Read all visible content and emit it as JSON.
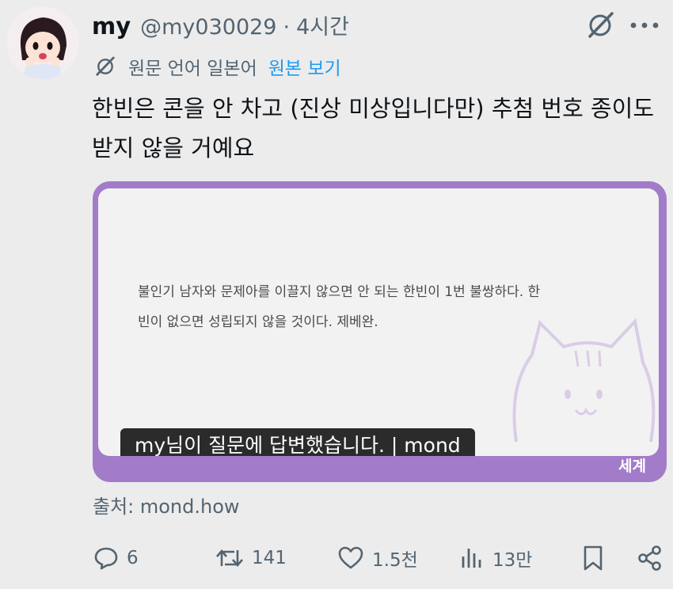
{
  "post": {
    "display_name": "my",
    "handle": "@my030029",
    "separator": "·",
    "time": "4시간",
    "translation": {
      "source_lang": "원문 언어 일본어",
      "view_original": "원본 보기"
    },
    "text": "한빈은 콘을 안 차고 (진상 미상입니다만) 추첨 번호 종이도 받지 않을 거예요",
    "card": {
      "quote": "불인기 남자와 문제아를 이끌지 않으면 안 되는 한빈이 1번 불쌍하다. 한빈이 없으면 성립되지 않을 것이다. 제베완.",
      "caption": "my님이 질문에 답변했습니다. | mond",
      "corner_label": "세계"
    },
    "source": "출처: mond.how",
    "stats": {
      "replies": "6",
      "reposts": "141",
      "likes": "1.5천",
      "views": "13만"
    }
  },
  "colors": {
    "card_border": "#a27cc9",
    "link": "#1d9bf0",
    "muted": "#536471"
  }
}
